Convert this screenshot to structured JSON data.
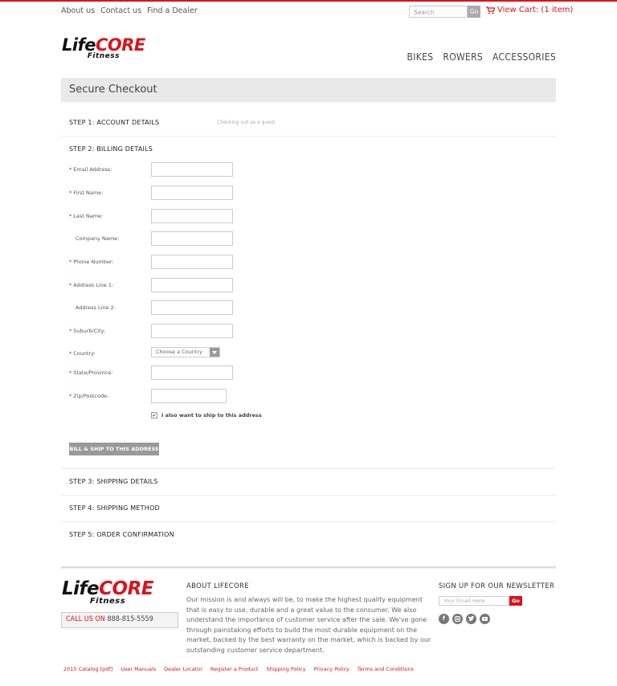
{
  "top_links": [
    "About us",
    "Contact us",
    "Find a Dealer"
  ],
  "search": {
    "placeholder": "Search",
    "go": "Go"
  },
  "cart": {
    "label": "View Cart:",
    "count": "(1 item)"
  },
  "logo": {
    "part1": "Life",
    "part2": "CORE",
    "sub": "Fitness"
  },
  "nav": [
    "BIKES",
    "ROWERS",
    "ACCESSORIES"
  ],
  "checkout_title": "Secure Checkout",
  "steps": {
    "s1": "STEP 1: ACCOUNT DETAILS",
    "s1_note": "Checking out as a guest",
    "s2": "STEP 2: BILLING DETAILS",
    "s3": "STEP 3: SHIPPING DETAILS",
    "s4": "STEP 4: SHIPPING METHOD",
    "s5": "STEP 5: ORDER CONFIRMATION"
  },
  "fields": [
    {
      "label": "Email Address:",
      "required": "*"
    },
    {
      "label": "First Name:",
      "required": "*"
    },
    {
      "label": "Last Name:",
      "required": "*"
    },
    {
      "label": "Company Name:",
      "required": ""
    },
    {
      "label": "Phone Number:",
      "required": "*"
    },
    {
      "label": "Address Line 1:",
      "required": "*"
    },
    {
      "label": "Address Line 2:",
      "required": ""
    },
    {
      "label": "Suburb/City:",
      "required": "*"
    },
    {
      "label": "Country:",
      "required": "*"
    },
    {
      "label": "State/Province:",
      "required": "*"
    },
    {
      "label": "Zip/Postcode:",
      "required": "*"
    }
  ],
  "country_select": "Choose a Country",
  "ship_checkbox": {
    "checked": "✔",
    "label": "I also want to ship to this address"
  },
  "bill_button": "BILL & SHIP TO THIS ADDRESS",
  "footer": {
    "about_title": "ABOUT LIFECORE",
    "about_text": "Our mission is and always will be, to make the highest quality equipment that is easy to use, durable and a great value to the consumer. We also understand the importance of customer service after the sale. We've gone through painstaking efforts to build the most durable equipment on the market, backed by the best warranty on the market, which is backed by our outstanding customer service department.",
    "call_label": "CALL US ON",
    "phone": "888-815-5559",
    "newsletter_title": "SIGN UP FOR OUR NEWSLETTER",
    "newsletter_placeholder": "Your Email Here",
    "newsletter_go": "Go",
    "social_icons": [
      "facebook-icon",
      "instagram-icon",
      "twitter-icon",
      "youtube-icon"
    ],
    "links": [
      "2015 Catalog [pdf]",
      "User Manuals",
      "Dealer Locator",
      "Register a Product",
      "Shipping Policy",
      "Privacy Policy",
      "Terms and Conditions"
    ]
  },
  "colors": {
    "accent": "#d9141b",
    "header_bg": "#e9e9e9",
    "button_bg": "#999999"
  }
}
